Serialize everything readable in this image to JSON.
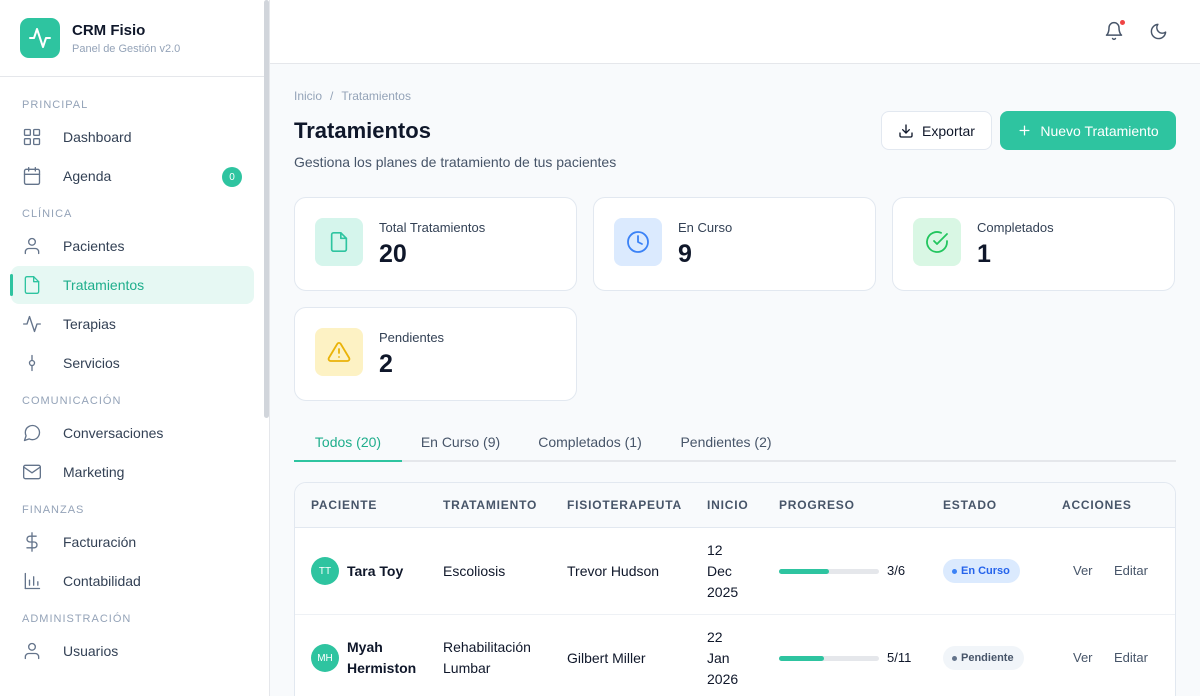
{
  "brand": {
    "title": "CRM Fisio",
    "subtitle": "Panel de Gestión v2.0"
  },
  "sidebar": {
    "sections": [
      {
        "label": "PRINCIPAL",
        "items": [
          {
            "label": "Dashboard",
            "icon": "grid-icon"
          },
          {
            "label": "Agenda",
            "icon": "calendar-icon",
            "badge": "0"
          }
        ]
      },
      {
        "label": "CLÍNICA",
        "items": [
          {
            "label": "Pacientes",
            "icon": "user-icon"
          },
          {
            "label": "Tratamientos",
            "icon": "file-icon",
            "active": true
          },
          {
            "label": "Terapias",
            "icon": "activity-icon"
          },
          {
            "label": "Servicios",
            "icon": "git-commit-icon"
          }
        ]
      },
      {
        "label": "COMUNICACIÓN",
        "items": [
          {
            "label": "Conversaciones",
            "icon": "message-circle-icon"
          },
          {
            "label": "Marketing",
            "icon": "mail-icon"
          }
        ]
      },
      {
        "label": "FINANZAS",
        "items": [
          {
            "label": "Facturación",
            "icon": "dollar-icon"
          },
          {
            "label": "Contabilidad",
            "icon": "bar-chart-icon"
          }
        ]
      },
      {
        "label": "ADMINISTRACIÓN",
        "items": [
          {
            "label": "Usuarios",
            "icon": "user-icon"
          }
        ]
      }
    ]
  },
  "breadcrumb": {
    "home": "Inicio",
    "separator": "/",
    "current": "Tratamientos"
  },
  "page": {
    "title": "Tratamientos",
    "subtitle": "Gestiona los planes de tratamiento de tus pacientes"
  },
  "actions": {
    "export_label": "Exportar",
    "new_label": "Nuevo Tratamiento"
  },
  "stats": [
    {
      "label": "Total Tratamientos",
      "value": "20",
      "icon": "file-icon",
      "color": "#2ec4a0",
      "bg": "#d5f5ec"
    },
    {
      "label": "En Curso",
      "value": "9",
      "icon": "clock-icon",
      "color": "#3b82f6",
      "bg": "#dbeafe"
    },
    {
      "label": "Completados",
      "value": "1",
      "icon": "check-circle-icon",
      "color": "#22c55e",
      "bg": "#d9f7e4"
    },
    {
      "label": "Pendientes",
      "value": "2",
      "icon": "alert-triangle-icon",
      "color": "#eab308",
      "bg": "#fdf2c4"
    }
  ],
  "tabs": [
    {
      "label": "Todos (20)",
      "active": true
    },
    {
      "label": "En Curso (9)"
    },
    {
      "label": "Completados (1)"
    },
    {
      "label": "Pendientes (2)"
    }
  ],
  "table": {
    "headers": [
      "PACIENTE",
      "TRATAMIENTO",
      "FISIOTERAPEUTA",
      "INICIO",
      "PROGRESO",
      "ESTADO",
      "ACCIONES"
    ],
    "rows": [
      {
        "initials": "TT",
        "patient": [
          "Tara Toy"
        ],
        "treatment": [
          "Escoliosis"
        ],
        "therapist": "Trevor Hudson",
        "start": [
          "12",
          "Dec",
          "2025"
        ],
        "progress": "3/6",
        "progress_fraction": 0.5,
        "status": "En Curso",
        "status_kind": "curso",
        "view": "Ver",
        "edit": "Editar"
      },
      {
        "initials": "MH",
        "patient": [
          "Myah",
          "Hermiston"
        ],
        "treatment": [
          "Rehabilitación",
          "Lumbar"
        ],
        "therapist": "Gilbert Miller",
        "start": [
          "22",
          "Jan",
          "2026"
        ],
        "progress": "5/11",
        "progress_fraction": 0.4545,
        "status": "Pendiente",
        "status_kind": "pend",
        "view": "Ver",
        "edit": "Editar"
      }
    ]
  },
  "colors": {
    "accent": "#2ec4a0",
    "notification": "#ef4444"
  }
}
